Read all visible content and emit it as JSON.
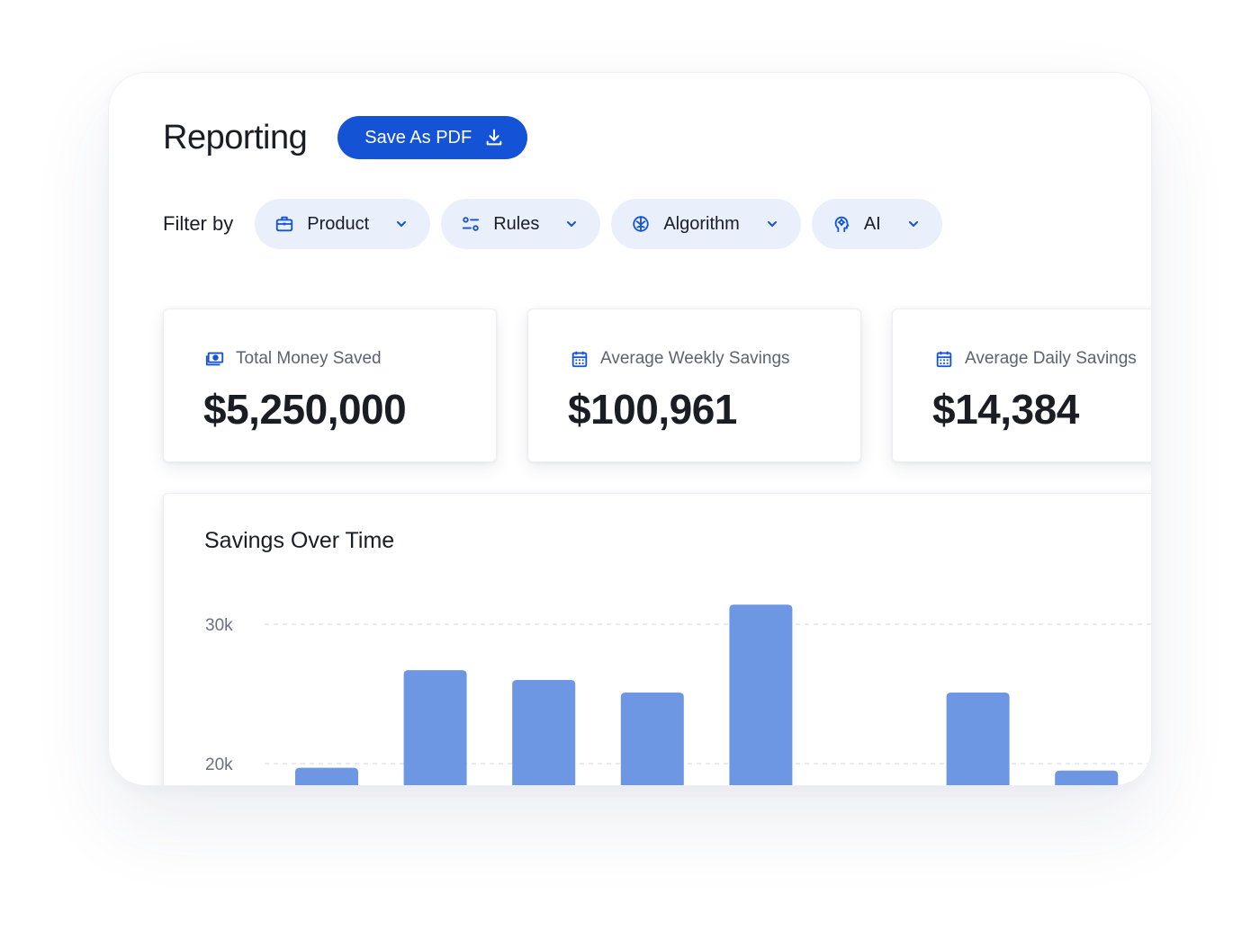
{
  "header": {
    "title": "Reporting",
    "save_button_label": "Save As PDF",
    "save_button_icon": "download-icon"
  },
  "filters": {
    "label": "Filter by",
    "chips": [
      {
        "label": "Product",
        "icon": "briefcase-icon"
      },
      {
        "label": "Rules",
        "icon": "rules-icon"
      },
      {
        "label": "Algorithm",
        "icon": "brain-icon"
      },
      {
        "label": "AI",
        "icon": "ai-head-icon"
      }
    ]
  },
  "stats": [
    {
      "label": "Total Money Saved",
      "value": "$5,250,000",
      "icon": "money-icon"
    },
    {
      "label": "Average Weekly Savings",
      "value": "$100,961",
      "icon": "calendar-icon"
    },
    {
      "label": "Average Daily Savings",
      "value": "$14,384",
      "icon": "calendar-icon"
    }
  ],
  "colors": {
    "accent": "#1452d6",
    "chip_bg": "#eaf0fb",
    "bar": "#6d96e3",
    "icon": "#1452d6"
  },
  "chart": {
    "title": "Savings Over Time"
  },
  "chart_data": {
    "type": "bar",
    "title": "Savings Over Time",
    "xlabel": "",
    "ylabel": "",
    "ytick_labels": [
      "20k",
      "30k"
    ],
    "yticks": [
      20000,
      30000
    ],
    "grid": true,
    "values": [
      19700,
      26700,
      26000,
      25100,
      31400,
      null,
      25100,
      19500
    ]
  }
}
